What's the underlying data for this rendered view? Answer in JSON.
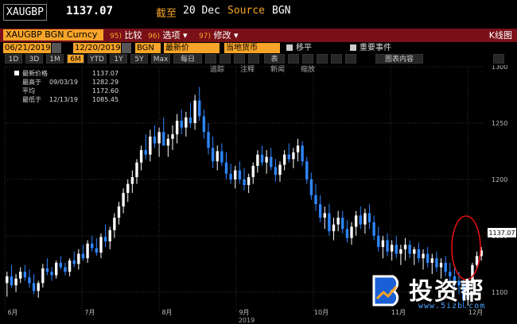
{
  "header": {
    "ticker": "XAUGBP",
    "price": "1137.07",
    "asof_label": "截至",
    "date": "20 Dec",
    "source_label": "Source",
    "source_value": "BGN"
  },
  "menubar": {
    "security": "XAUGBP BGN Curncy",
    "items": [
      {
        "num": "95)",
        "label": "比较"
      },
      {
        "num": "96)",
        "label": "选项"
      },
      {
        "num": "97)",
        "label": "修改"
      }
    ],
    "right_label": "K线图"
  },
  "fields": {
    "start_date": "06/21/2019",
    "end_date": "12/20/2019",
    "source": "BGN",
    "price_type": "最新价",
    "currency": "当地货币",
    "move_label": "移平",
    "events_label": "重要事件"
  },
  "periods": {
    "items": [
      "1D",
      "3D",
      "1M",
      "6M",
      "YTD",
      "1Y",
      "5Y",
      "Max"
    ],
    "active": "6M",
    "frequency": "每日",
    "table_label": "表",
    "chart_content_label": "图表内容"
  },
  "toolbar": {
    "items": [
      "追踪",
      "注释",
      "新闻",
      "缩放"
    ]
  },
  "legend": {
    "items": [
      {
        "label": "最新价格",
        "date": "",
        "value": "1137.07"
      },
      {
        "label": "最高于",
        "date": "09/03/19",
        "value": "1282.29"
      },
      {
        "label": "平均",
        "date": "",
        "value": "1172.60"
      },
      {
        "label": "最低于",
        "date": "12/13/19",
        "value": "1085.45"
      }
    ]
  },
  "watermark": {
    "text": "投资帮",
    "url": "www.5izb.com"
  },
  "colors": {
    "up": "#ffffff",
    "down": "#2e86ff",
    "accent": "#f7a428",
    "menubar": "#7a1018",
    "highlight_circle": "#e01010"
  },
  "chart_data": {
    "type": "candlestick",
    "title": "",
    "xlabel": "2019",
    "ylabel": "",
    "ylim": [
      1090,
      1300
    ],
    "y_ticks": [
      1100,
      1150,
      1200,
      1250,
      1300
    ],
    "x_tick_labels": [
      "6月",
      "7月",
      "8月",
      "9月",
      "10月",
      "11月",
      "12月"
    ],
    "last_price_label": "1137.07",
    "series": [
      {
        "name": "XAUGBP",
        "ohlc": [
          [
            1108,
            1118,
            1096,
            1114
          ],
          [
            1114,
            1124,
            1104,
            1106
          ],
          [
            1106,
            1116,
            1100,
            1112
          ],
          [
            1112,
            1122,
            1108,
            1118
          ],
          [
            1118,
            1124,
            1110,
            1113
          ],
          [
            1113,
            1120,
            1104,
            1108
          ],
          [
            1108,
            1116,
            1098,
            1101
          ],
          [
            1101,
            1110,
            1095,
            1108
          ],
          [
            1108,
            1125,
            1104,
            1121
          ],
          [
            1121,
            1130,
            1115,
            1118
          ],
          [
            1118,
            1122,
            1110,
            1115
          ],
          [
            1115,
            1128,
            1112,
            1126
          ],
          [
            1126,
            1132,
            1120,
            1122
          ],
          [
            1122,
            1126,
            1115,
            1118
          ],
          [
            1118,
            1130,
            1114,
            1128
          ],
          [
            1128,
            1136,
            1122,
            1125
          ],
          [
            1125,
            1138,
            1120,
            1134
          ],
          [
            1134,
            1142,
            1128,
            1130
          ],
          [
            1130,
            1146,
            1126,
            1143
          ],
          [
            1143,
            1150,
            1136,
            1139
          ],
          [
            1139,
            1148,
            1132,
            1135
          ],
          [
            1135,
            1152,
            1130,
            1149
          ],
          [
            1149,
            1160,
            1140,
            1145
          ],
          [
            1145,
            1158,
            1138,
            1155
          ],
          [
            1155,
            1170,
            1148,
            1166
          ],
          [
            1166,
            1180,
            1160,
            1176
          ],
          [
            1176,
            1192,
            1170,
            1188
          ],
          [
            1188,
            1200,
            1180,
            1196
          ],
          [
            1196,
            1208,
            1188,
            1202
          ],
          [
            1202,
            1218,
            1196,
            1215
          ],
          [
            1215,
            1230,
            1208,
            1226
          ],
          [
            1226,
            1240,
            1218,
            1222
          ],
          [
            1222,
            1244,
            1216,
            1238
          ],
          [
            1238,
            1248,
            1228,
            1232
          ],
          [
            1232,
            1246,
            1220,
            1242
          ],
          [
            1242,
            1255,
            1234,
            1230
          ],
          [
            1230,
            1240,
            1220,
            1236
          ],
          [
            1236,
            1248,
            1226,
            1240
          ],
          [
            1240,
            1258,
            1232,
            1252
          ],
          [
            1252,
            1262,
            1240,
            1246
          ],
          [
            1246,
            1260,
            1238,
            1255
          ],
          [
            1255,
            1268,
            1246,
            1250
          ],
          [
            1250,
            1275,
            1244,
            1270
          ],
          [
            1270,
            1282,
            1252,
            1256
          ],
          [
            1256,
            1262,
            1236,
            1242
          ],
          [
            1242,
            1250,
            1222,
            1228
          ],
          [
            1228,
            1238,
            1210,
            1216
          ],
          [
            1216,
            1230,
            1208,
            1225
          ],
          [
            1225,
            1232,
            1212,
            1215
          ],
          [
            1215,
            1224,
            1200,
            1205
          ],
          [
            1205,
            1214,
            1196,
            1200
          ],
          [
            1200,
            1212,
            1192,
            1208
          ],
          [
            1208,
            1216,
            1196,
            1200
          ],
          [
            1200,
            1210,
            1190,
            1195
          ],
          [
            1195,
            1205,
            1188,
            1202
          ],
          [
            1202,
            1215,
            1196,
            1212
          ],
          [
            1212,
            1226,
            1206,
            1222
          ],
          [
            1222,
            1230,
            1212,
            1215
          ],
          [
            1215,
            1226,
            1205,
            1220
          ],
          [
            1220,
            1228,
            1208,
            1211
          ],
          [
            1211,
            1218,
            1198,
            1204
          ],
          [
            1204,
            1216,
            1198,
            1213
          ],
          [
            1213,
            1226,
            1208,
            1222
          ],
          [
            1222,
            1232,
            1215,
            1218
          ],
          [
            1218,
            1228,
            1210,
            1224
          ],
          [
            1224,
            1236,
            1216,
            1230
          ],
          [
            1230,
            1234,
            1212,
            1216
          ],
          [
            1216,
            1220,
            1196,
            1200
          ],
          [
            1200,
            1206,
            1182,
            1186
          ],
          [
            1186,
            1196,
            1172,
            1178
          ],
          [
            1178,
            1186,
            1162,
            1166
          ],
          [
            1166,
            1176,
            1156,
            1170
          ],
          [
            1170,
            1178,
            1150,
            1154
          ],
          [
            1154,
            1166,
            1146,
            1160
          ],
          [
            1160,
            1172,
            1154,
            1166
          ],
          [
            1166,
            1172,
            1152,
            1156
          ],
          [
            1156,
            1164,
            1144,
            1148
          ],
          [
            1148,
            1162,
            1142,
            1158
          ],
          [
            1158,
            1172,
            1150,
            1168
          ],
          [
            1168,
            1176,
            1156,
            1160
          ],
          [
            1160,
            1174,
            1152,
            1170
          ],
          [
            1170,
            1178,
            1156,
            1162
          ],
          [
            1162,
            1168,
            1146,
            1150
          ],
          [
            1150,
            1158,
            1136,
            1140
          ],
          [
            1140,
            1150,
            1130,
            1146
          ],
          [
            1146,
            1152,
            1132,
            1136
          ],
          [
            1136,
            1146,
            1128,
            1142
          ],
          [
            1142,
            1150,
            1130,
            1134
          ],
          [
            1134,
            1142,
            1124,
            1138
          ],
          [
            1138,
            1148,
            1128,
            1142
          ],
          [
            1142,
            1146,
            1130,
            1134
          ],
          [
            1134,
            1140,
            1124,
            1138
          ],
          [
            1138,
            1144,
            1126,
            1130
          ],
          [
            1130,
            1138,
            1120,
            1134
          ],
          [
            1134,
            1140,
            1122,
            1126
          ],
          [
            1126,
            1134,
            1116,
            1130
          ],
          [
            1130,
            1136,
            1118,
            1122
          ],
          [
            1122,
            1130,
            1112,
            1126
          ],
          [
            1126,
            1132,
            1114,
            1118
          ],
          [
            1118,
            1126,
            1108,
            1114
          ],
          [
            1114,
            1122,
            1102,
            1110
          ],
          [
            1110,
            1118,
            1098,
            1106
          ],
          [
            1106,
            1112,
            1086,
            1093
          ],
          [
            1093,
            1112,
            1088,
            1108
          ],
          [
            1108,
            1126,
            1104,
            1124
          ],
          [
            1124,
            1136,
            1120,
            1132
          ],
          [
            1132,
            1140,
            1128,
            1137
          ]
        ]
      }
    ]
  }
}
